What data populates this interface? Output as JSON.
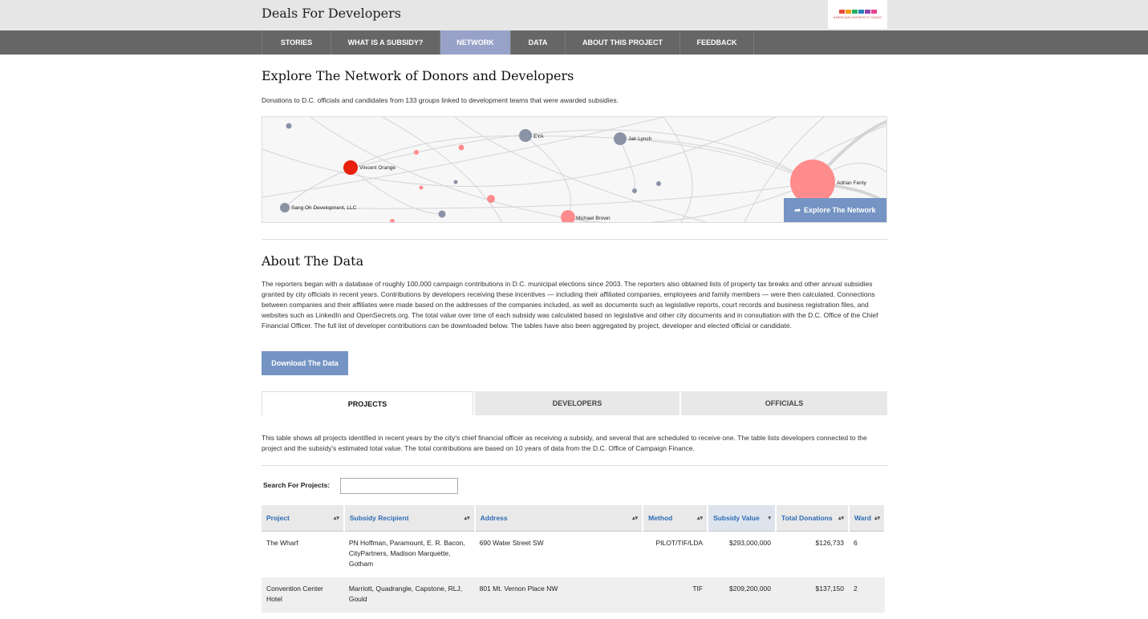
{
  "site": {
    "title": "Deals For Developers",
    "logo_text": "AMERICAN UNIVERSITY RADIO",
    "logo_colors": [
      "#e74c3c",
      "#f39c12",
      "#27ae60",
      "#2980b9",
      "#8e44ad",
      "#e84393"
    ]
  },
  "nav": {
    "items": [
      {
        "label": "STORIES"
      },
      {
        "label": "WHAT IS A SUBSIDY?"
      },
      {
        "label": "NETWORK"
      },
      {
        "label": "DATA"
      },
      {
        "label": "ABOUT THIS PROJECT"
      },
      {
        "label": "FEEDBACK"
      }
    ],
    "active": "NETWORK",
    "active_color": "#98a2c8"
  },
  "network": {
    "heading": "Explore The Network of Donors and Developers",
    "description": "Donations to D.C. officials and candidates from 133 groups linked to development teams that were awarded subsidies.",
    "explore_label": "Explore The Network",
    "explore_icon": "share-arrow-icon",
    "node_labels": {
      "vincent_orange": "Vincent Orange",
      "eya": "EYA",
      "jair_lynch": "Jair Lynch",
      "adrian_fenty": "Adrian Fenty",
      "sang_oh": "Sang Oh Development, LLC",
      "michael_brown": "Michael Brown"
    },
    "colors": {
      "official": "#ff8c8c",
      "highlight": "#e8200c",
      "developer": "#8a92a6"
    }
  },
  "about": {
    "heading": "About The Data",
    "text": "The reporters began with a database of roughly 100,000 campaign contributions in D.C. municipal elections since 2003. The reporters also obtained lists of property tax breaks and other annual subsidies granted by city officials in recent years. Contributions by developers receiving these incentives — including their affiliated companies, employees and family members — were then calculated. Connections between companies and their affiliates were made based on the addresses of the companies included, as well as documents such as legislative reports, court records and business registration files, and websites such as LinkedIn and OpenSecrets.org. The total value over time of each subsidy was calculated based on legislative and other city documents and in consultation with the D.C. Office of the Chief Financial Officer. The full list of developer contributions can be downloaded below. The tables have also been aggregated by project, developer and elected official or candidate.",
    "download_label": "Download The Data"
  },
  "tabs": [
    {
      "label": "PROJECTS"
    },
    {
      "label": "DEVELOPERS"
    },
    {
      "label": "OFFICIALS"
    }
  ],
  "active_tab": "PROJECTS",
  "projects": {
    "description": "This table shows all projects identified in recent years by the city's chief financial officer as receiving a subsidy, and several that are scheduled to receive one. The table lists developers connected to the project and the subsidy's estimated total value. The total contributions are based on 10 years of data from the D.C. Office of Campaign Finance.",
    "search_label": "Search For Projects:",
    "search_value": "",
    "search_placeholder": "",
    "columns": [
      "Project",
      "Subsidy Recipient",
      "Address",
      "Method",
      "Subsidy Value",
      "Total Donations",
      "Ward"
    ],
    "sorted_column": "Subsidy Value",
    "sort_direction": "descending",
    "rows": [
      [
        "The Wharf",
        "PN Hoffman, Paramount, E. R. Bacon, CityPartners, Madison Marquette, Gotham",
        "690 Water Street SW",
        "PILOT/TIF/LDA",
        "$293,000,000",
        "$126,733",
        "6"
      ],
      [
        "Convention Center Hotel",
        "Marriott, Quadrangle, Capstone, RLJ, Gould",
        "801 Mt. Vernon Place NW",
        "TIF",
        "$209,200,000",
        "$137,150",
        "2"
      ]
    ]
  }
}
